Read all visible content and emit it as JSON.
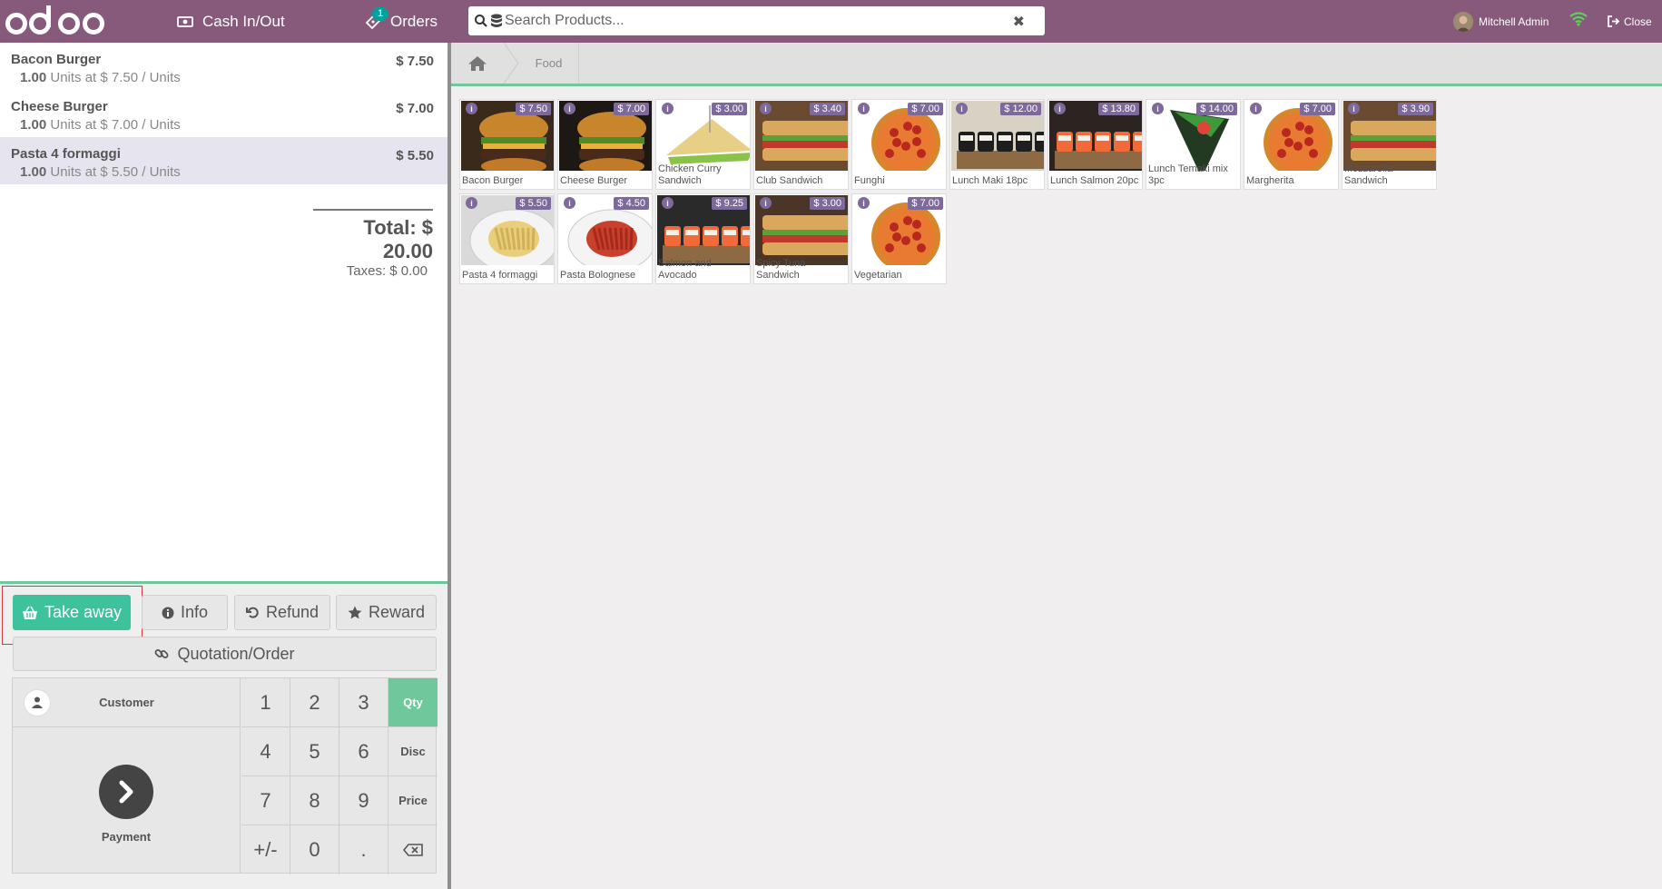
{
  "header": {
    "logo_text": "odoo",
    "cash_label": "Cash In/Out",
    "orders_label": "Orders",
    "orders_badge": "1",
    "search_placeholder": "Search Products...",
    "user_name": "Mitchell Admin",
    "close_label": "Close"
  },
  "order": {
    "lines": [
      {
        "name": "Bacon Burger",
        "price": "$ 7.50",
        "qty": "1.00",
        "detail": "Units at $ 7.50 / Units",
        "selected": false
      },
      {
        "name": "Cheese Burger",
        "price": "$ 7.00",
        "qty": "1.00",
        "detail": "Units at $ 7.00 / Units",
        "selected": false
      },
      {
        "name": "Pasta 4 formaggi",
        "price": "$ 5.50",
        "qty": "1.00",
        "detail": "Units at $ 5.50 / Units",
        "selected": true
      }
    ],
    "total": "Total: $ 20.00",
    "taxes": "Taxes: $ 0.00"
  },
  "actions": {
    "takeaway": "Take away",
    "info": "Info",
    "refund": "Refund",
    "reward": "Reward",
    "quotation": "Quotation/Order"
  },
  "numpad": {
    "customer": "Customer",
    "payment": "Payment",
    "keys": [
      "1",
      "2",
      "3",
      "4",
      "5",
      "6",
      "7",
      "8",
      "9",
      "+/-",
      "0",
      "."
    ],
    "modes": [
      "Qty",
      "Disc",
      "Price"
    ],
    "active_mode": "Qty"
  },
  "breadcrumb": {
    "category": "Food"
  },
  "products": [
    {
      "name": "Bacon Burger",
      "price": "$ 7.50",
      "icon": "burger"
    },
    {
      "name": "Cheese Burger",
      "price": "$ 7.00",
      "icon": "burger-dark"
    },
    {
      "name": "Chicken Curry Sandwich",
      "price": "$ 3.00",
      "icon": "sandwich-triangle"
    },
    {
      "name": "Club Sandwich",
      "price": "$ 3.40",
      "icon": "sandwich-club"
    },
    {
      "name": "Funghi",
      "price": "$ 7.00",
      "icon": "pizza"
    },
    {
      "name": "Lunch Maki 18pc",
      "price": "$ 12.00",
      "icon": "maki"
    },
    {
      "name": "Lunch Salmon 20pc",
      "price": "$ 13.80",
      "icon": "sushi"
    },
    {
      "name": "Lunch Temaki mix 3pc",
      "price": "$ 14.00",
      "icon": "temaki"
    },
    {
      "name": "Margherita",
      "price": "$ 7.00",
      "icon": "pizza"
    },
    {
      "name": "Mozzarella Sandwich",
      "price": "$ 3.90",
      "icon": "sandwich-club"
    },
    {
      "name": "Pasta 4 formaggi",
      "price": "$ 5.50",
      "icon": "pasta"
    },
    {
      "name": "Pasta Bolognese",
      "price": "$ 4.50",
      "icon": "pasta-red"
    },
    {
      "name": "Salmon and Avocado",
      "price": "$ 9.25",
      "icon": "sushi-plate"
    },
    {
      "name": "Spicy Tuna Sandwich",
      "price": "$ 3.00",
      "icon": "sandwich-grill"
    },
    {
      "name": "Vegetarian",
      "price": "$ 7.00",
      "icon": "pizza"
    }
  ],
  "colors": {
    "brand": "#875a7b",
    "accent_green": "#3ec19d",
    "price_tag": "#7d6a9b",
    "highlight": "#d23b3b"
  }
}
